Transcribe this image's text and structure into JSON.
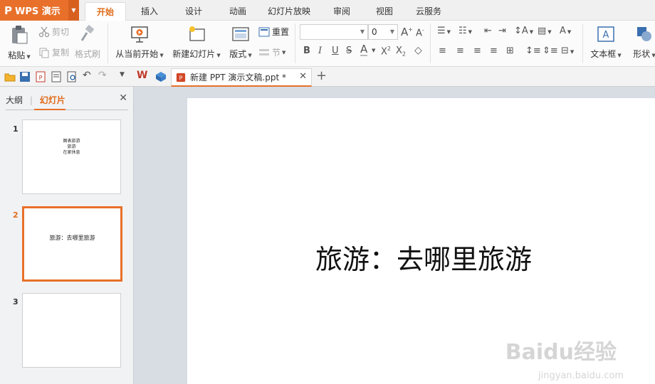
{
  "app": {
    "name": "WPS 演示",
    "logo_glyph": "P"
  },
  "tabs": [
    {
      "label": "开始",
      "active": true
    },
    {
      "label": "插入"
    },
    {
      "label": "设计"
    },
    {
      "label": "动画"
    },
    {
      "label": "幻灯片放映"
    },
    {
      "label": "审阅"
    },
    {
      "label": "视图"
    },
    {
      "label": "云服务"
    }
  ],
  "ribbon": {
    "paste": "粘贴",
    "cut": "剪切",
    "copy": "复制",
    "format_painter": "格式刷",
    "from_current": "从当前开始",
    "new_slide": "新建幻灯片",
    "layout": "版式",
    "reset": "重置",
    "section": "节",
    "font_name_value": "",
    "font_size_value": "0",
    "text_box": "文本框",
    "shape": "形状"
  },
  "document": {
    "tab_title": "新建 PPT 演示文稿.ppt *"
  },
  "panel": {
    "outline_tab": "大纲",
    "slides_tab": "幻灯片"
  },
  "slides": [
    {
      "number": "1",
      "lines": [
        "图表旅游",
        "旅游",
        "在家休息"
      ]
    },
    {
      "number": "2",
      "lines": [
        "旅游：去哪里旅游"
      ],
      "selected": true
    },
    {
      "number": "3",
      "lines": []
    }
  ],
  "current_slide": {
    "title": "旅游：去哪里旅游"
  },
  "watermark": {
    "brand": "Baidu经验",
    "url": "jingyan.baidu.com"
  },
  "colors": {
    "accent": "#e8702a",
    "active_tab_text": "#e06c1c"
  }
}
